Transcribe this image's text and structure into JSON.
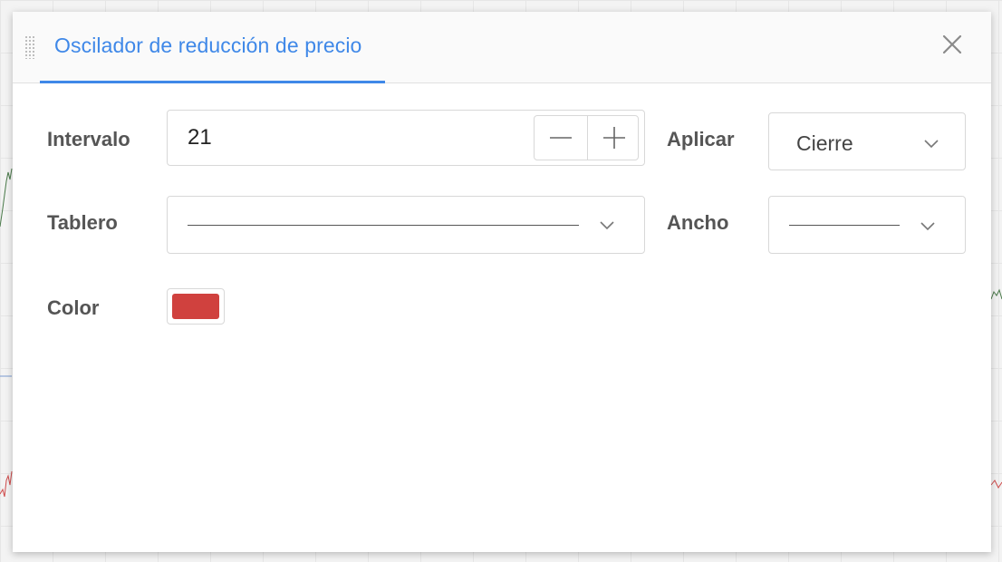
{
  "dialog": {
    "title": "Oscilador de reducción de precio",
    "accent_color": "#3f88e8",
    "close_icon": "close-icon",
    "drag_icon": "drag-handle-icon"
  },
  "form": {
    "intervalo": {
      "label": "Intervalo",
      "value": "21",
      "decrement_icon": "minus-icon",
      "increment_icon": "plus-icon"
    },
    "aplicar": {
      "label": "Aplicar",
      "selected": "Cierre"
    },
    "tablero": {
      "label": "Tablero",
      "selected_style": "solid-line"
    },
    "ancho": {
      "label": "Ancho",
      "selected_style": "thin-line"
    },
    "color": {
      "label": "Color",
      "value": "#d0413e"
    }
  }
}
